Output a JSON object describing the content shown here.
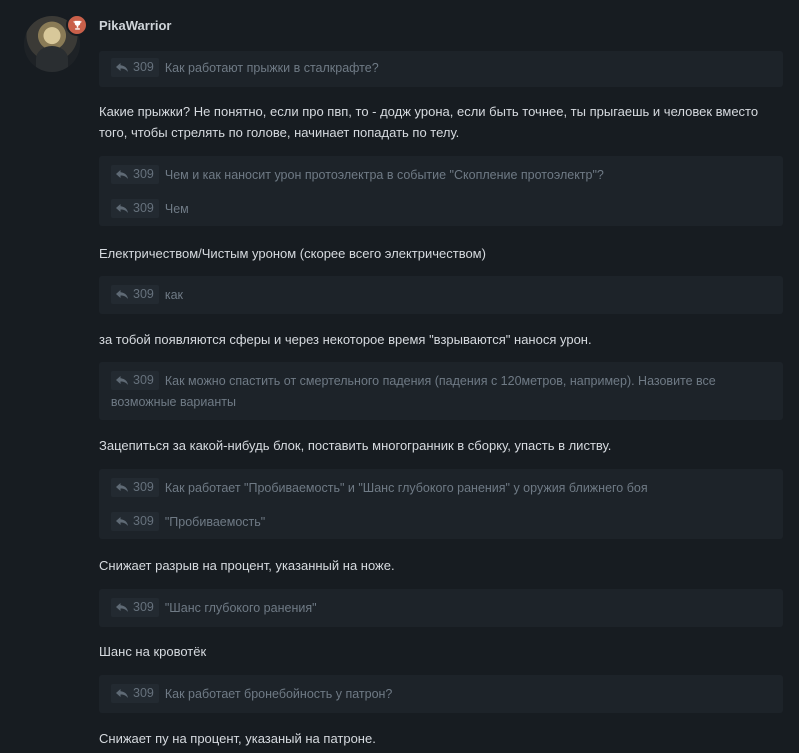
{
  "post": {
    "username": "PikaWarrior"
  },
  "quotes": [
    {
      "id": "309",
      "text": "Как работают прыжки в сталкрафте?"
    },
    {
      "id": "309",
      "text": "Чем и как наносит урон протоэлектра в событие \"Скопление протоэлектр\"?"
    },
    {
      "id": "309",
      "text": "Чем"
    },
    {
      "id": "309",
      "text": "как"
    },
    {
      "id": "309",
      "text": "Как можно спастить от смертельного падения (падения с 120метров, например). Назовите все возможные варианты"
    },
    {
      "id": "309",
      "text": "Как работает \"Пробиваемость\" и \"Шанс глубокого ранения\" у оружия ближнего боя"
    },
    {
      "id": "309",
      "text": "\"Пробиваемость\""
    },
    {
      "id": "309",
      "text": "\"Шанс глубокого ранения\""
    },
    {
      "id": "309",
      "text": "Как работает бронебойность у патрон?"
    }
  ],
  "answers": [
    "Какие прыжки? Не понятно, если про пвп, то - додж урона, если быть точнее, ты прыгаешь и человек вместо того, чтобы стрелять по голове, начинает попадать по телу.",
    "Електричеством/Чистым уроном (скорее всего электричеством)",
    "за тобой появляются сферы и через некоторое время \"взрываются\" нанося урон.",
    "Зацепиться за какой-нибудь блок, поставить многогранник в сборку, упасть в листву.",
    "Снижает разрыв на процент, указанный на ноже.",
    "Шанс на кровотёк",
    "Снижает пу на процент, указаный на патроне."
  ]
}
